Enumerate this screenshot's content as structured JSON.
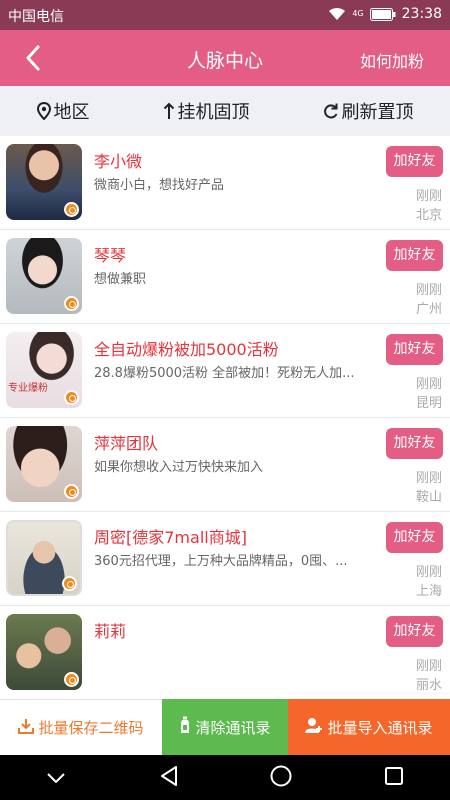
{
  "status_bar": {
    "carrier": "中国电信",
    "time": "23:38",
    "network_label": "4G"
  },
  "header": {
    "title": "人脉中心",
    "action": "如何加粉"
  },
  "filters": [
    {
      "label": "地区",
      "icon": "location-pin-icon"
    },
    {
      "label": "挂机固顶",
      "icon": "arrow-up-icon"
    },
    {
      "label": "刷新置顶",
      "icon": "refresh-icon"
    }
  ],
  "list": [
    {
      "name": "李小微",
      "desc": "微商小白，想找好产品",
      "button": "加好友",
      "time": "刚刚",
      "city": "北京"
    },
    {
      "name": "琴琴",
      "desc": "想做兼职",
      "button": "加好友",
      "time": "刚刚",
      "city": "广州"
    },
    {
      "name": "全自动爆粉被加5000活粉",
      "desc": "28.8爆粉5000活粉 全部被加！死粉无人加...",
      "button": "加好友",
      "time": "刚刚",
      "city": "昆明",
      "avatar_caption": "专业爆粉"
    },
    {
      "name": "萍萍团队",
      "desc": "如果你想收入过万快快来加入",
      "button": "加好友",
      "time": "刚刚",
      "city": "鞍山"
    },
    {
      "name": "周密[德家7mall商城]",
      "desc": "360元招代理，上万种大品牌精品，0囤、...",
      "button": "加好友",
      "time": "刚刚",
      "city": "上海"
    },
    {
      "name": "莉莉",
      "desc": "",
      "button": "加好友",
      "time": "刚刚",
      "city": "丽水"
    }
  ],
  "bottom_bar": {
    "save_qr": "批量保存二维码",
    "clear_contacts": "清除通讯录",
    "import_contacts": "批量导入通讯录"
  },
  "colors": {
    "status_bar": "#8b3a55",
    "header": "#e35d84",
    "name_red": "#e8333c",
    "save_orange": "#f07a2c",
    "clear_green": "#5cba4e",
    "import_orange": "#f5662a"
  }
}
